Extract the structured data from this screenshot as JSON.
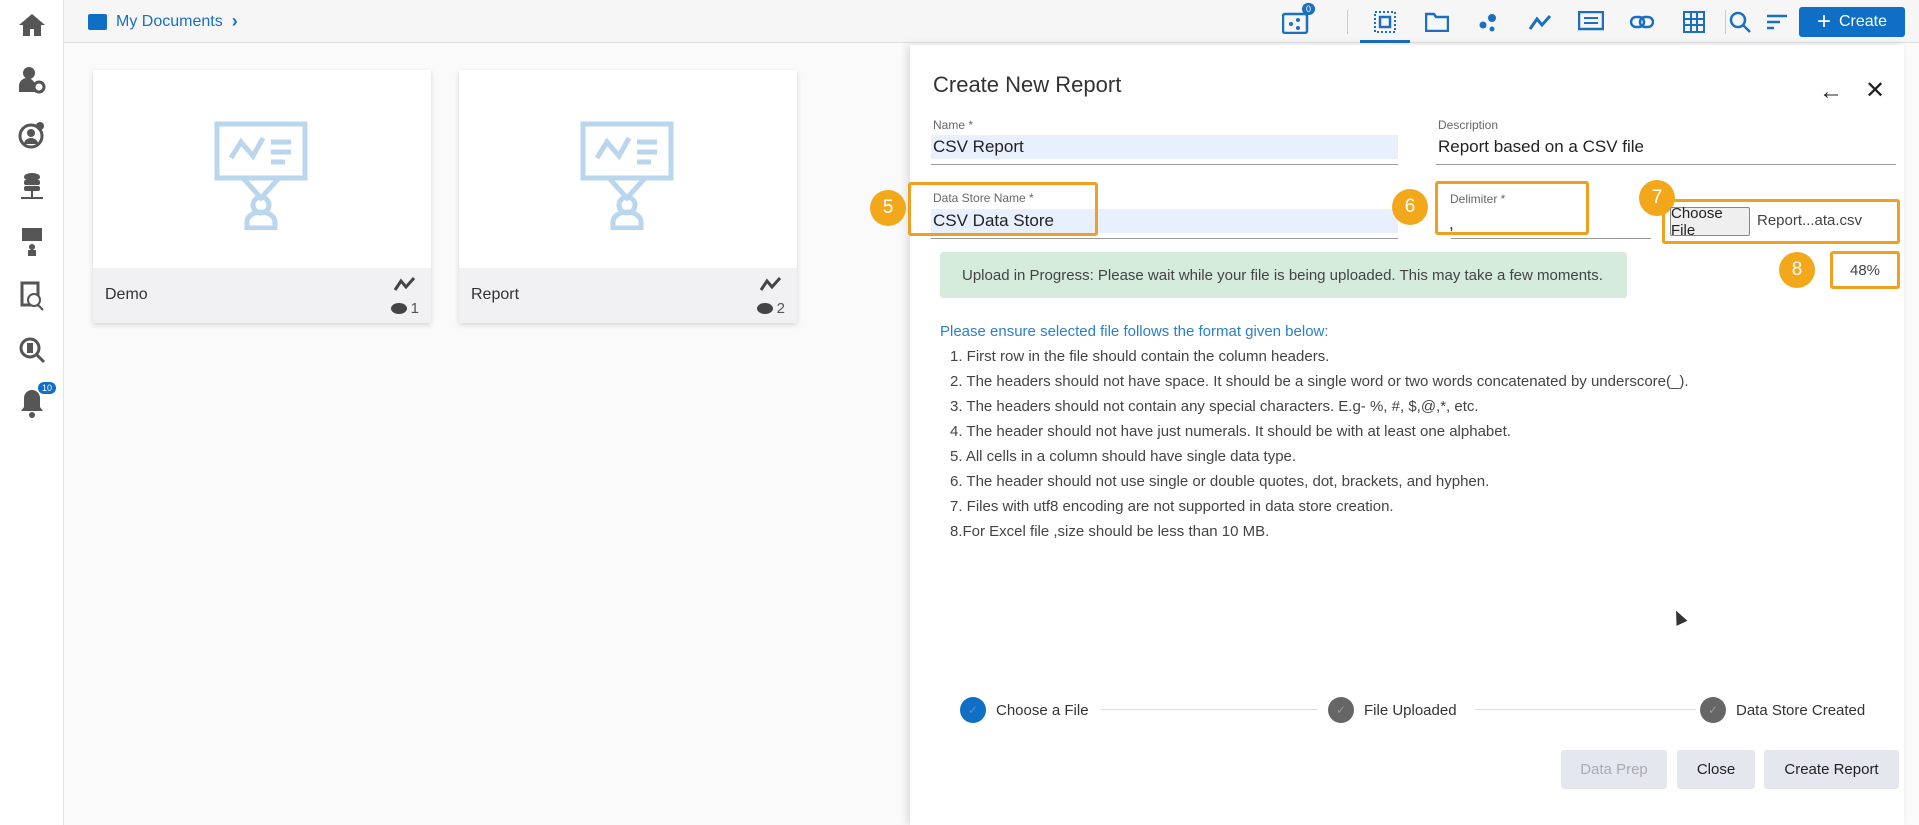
{
  "sidebar": {
    "items": [
      {
        "icon": "home-icon"
      },
      {
        "icon": "user-settings-icon"
      },
      {
        "icon": "user-alert-icon"
      },
      {
        "icon": "database-network-icon"
      },
      {
        "icon": "presentation-icon"
      },
      {
        "icon": "document-search-icon"
      },
      {
        "icon": "data-search-icon"
      },
      {
        "icon": "bell-icon",
        "badge": "10"
      }
    ]
  },
  "breadcrumb": {
    "label": "My Documents",
    "chevron": "›"
  },
  "topbar": {
    "share_badge": "0",
    "create_label": "Create",
    "create_plus": "+"
  },
  "cards": [
    {
      "name": "Demo",
      "views": "1"
    },
    {
      "name": "Report",
      "views": "2"
    }
  ],
  "panel": {
    "title": "Create New Report",
    "name_label": "Name *",
    "name_value": "CSV Report",
    "description_label": "Description",
    "description_value": "Report based on a CSV file",
    "datastore_label": "Data Store Name *",
    "datastore_value": "CSV Data Store",
    "delimiter_label": "Delimiter *",
    "delimiter_value": ",",
    "choose_file_label": "Choose File",
    "file_name": "Report...ata.csv",
    "alert": "Upload in Progress: Please wait while your file is being uploaded. This may take a few moments.",
    "progress_text": "48%",
    "progress": 48,
    "instructions_title": "Please ensure selected file follows the format given below:",
    "instructions": [
      "1. First row in the file should contain the column headers.",
      "2. The headers should not have space. It should be a single word or two words concatenated by underscore(_).",
      "3. The headers should not contain any special characters. E.g- %, #, $,@,*, etc.",
      "4. The header should not have just numerals. It should be with at least one alphabet.",
      "5. All cells in a column should have single data type.",
      "6. The header should not use single or double quotes, dot, brackets, and hyphen.",
      "7. Files with utf8 encoding are not supported in data store creation.",
      "8.For Excel file ,size should be less than 10 MB."
    ],
    "steps": [
      "Choose a File",
      "File Uploaded",
      "Data Store Created"
    ],
    "buttons": {
      "data_prep": "Data Prep",
      "close": "Close",
      "create_report": "Create Report"
    }
  },
  "annotations": [
    "5",
    "6",
    "7",
    "8"
  ],
  "colors": {
    "accent": "#0f6fc6",
    "annotation": "#f3a81b",
    "alert_bg": "#d5ebdc"
  }
}
